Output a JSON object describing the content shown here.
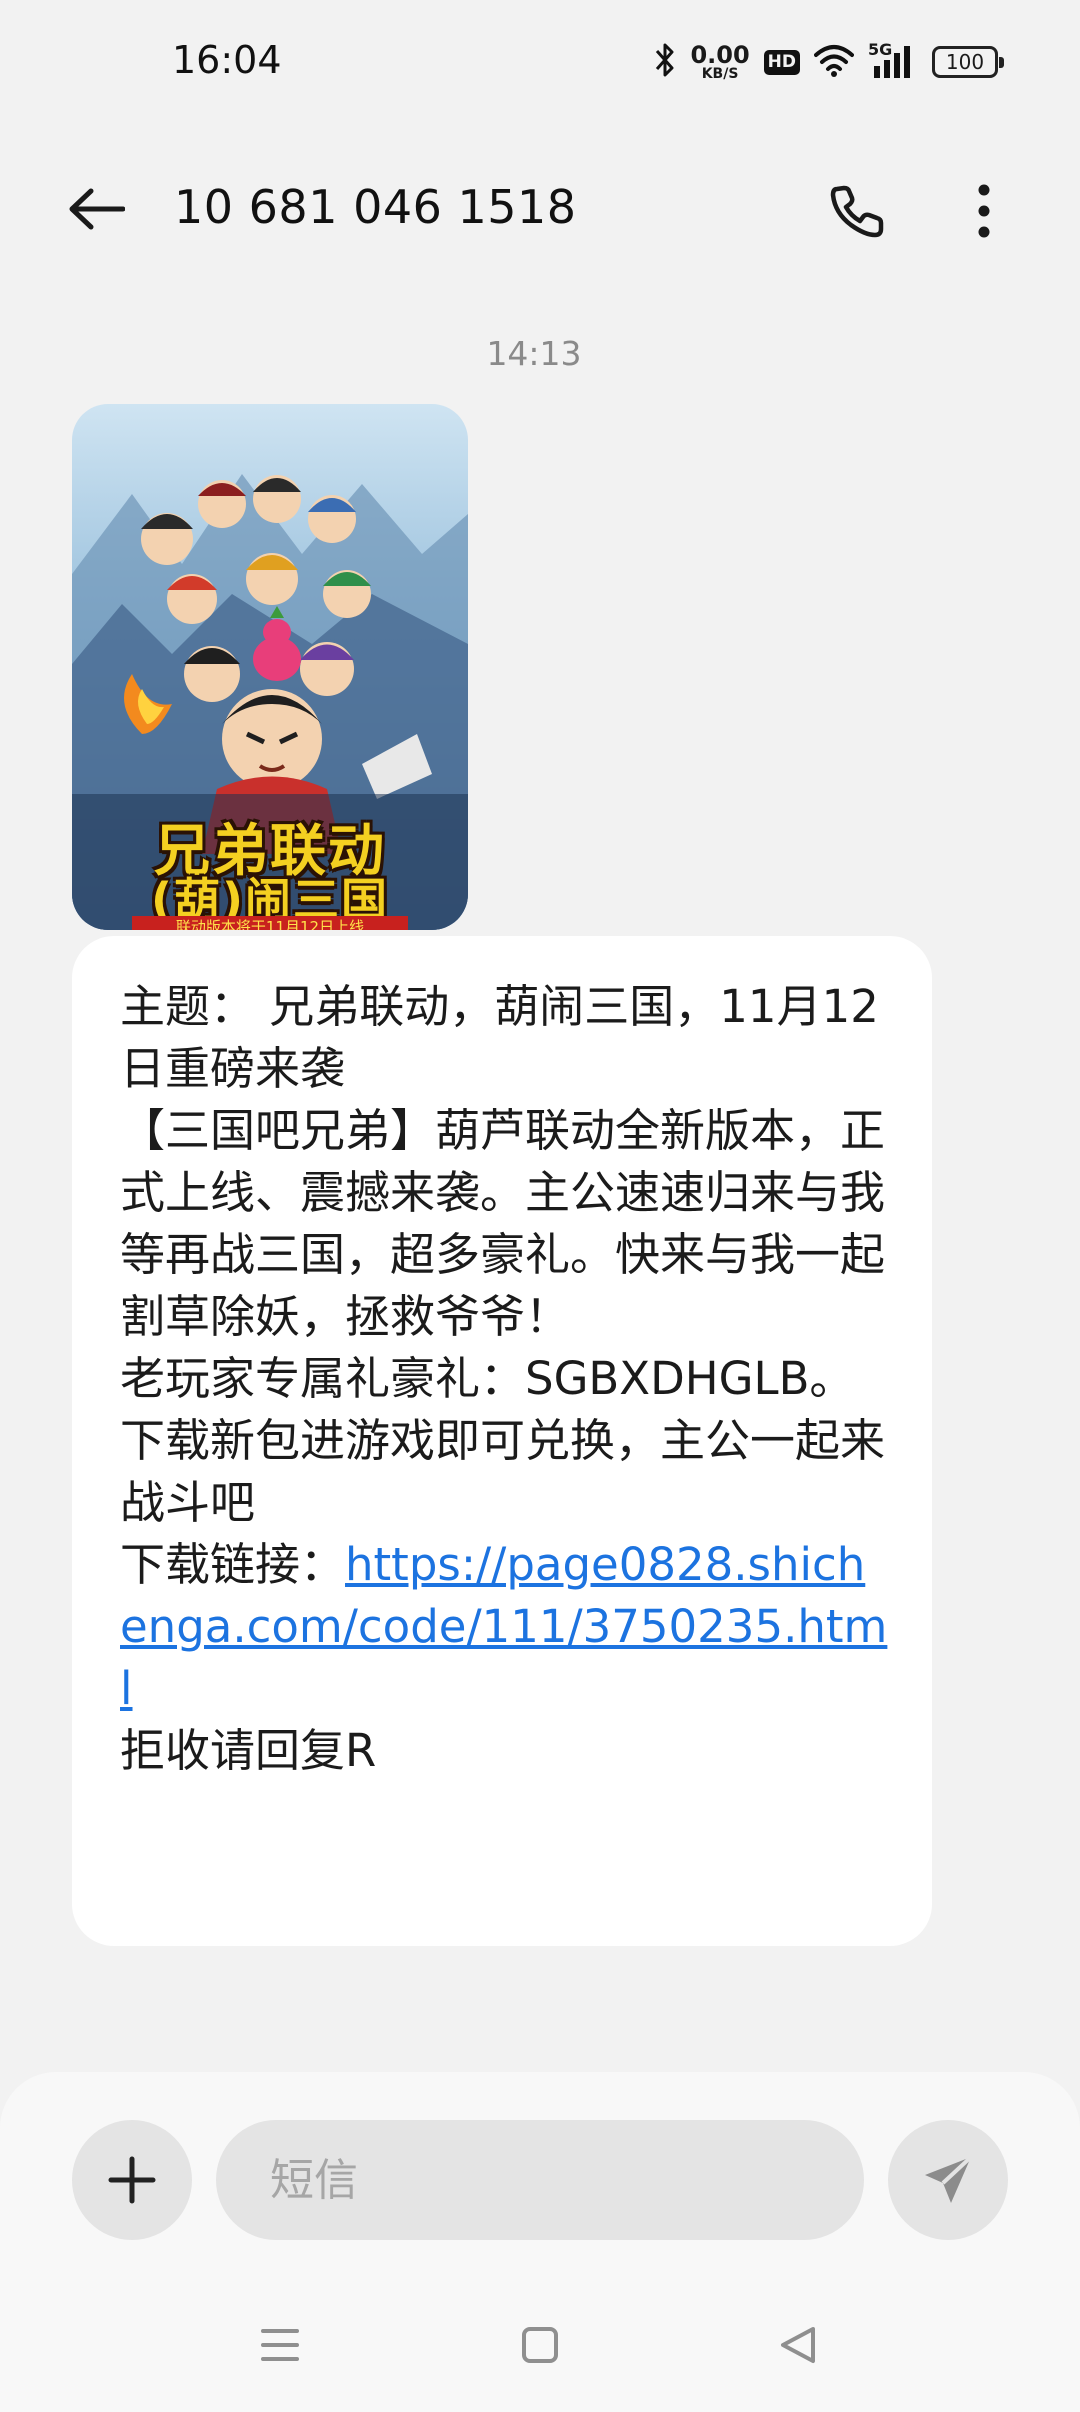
{
  "status_bar": {
    "time": "16:04",
    "net_speed_value": "0.00",
    "net_speed_unit": "KB/S",
    "hd_label": "HD",
    "network_label": "5G",
    "battery": "100"
  },
  "header": {
    "contact": "10 681 046 1518"
  },
  "conversation": {
    "timestamp": "14:13",
    "image": {
      "caption_line1": "兄弟联动",
      "caption_line2": "(葫)闹三国",
      "strip_text": "联动版本将于11月12日上线"
    },
    "message": {
      "subject": "主题： 兄弟联动，葫闹三国，11月12日重磅来袭",
      "body": "【三国吧兄弟】葫芦联动全新版本，正式上线、震撼来袭。主公速速归来与我等再战三国，超多豪礼。快来与我一起割草除妖，拯救爷爷！",
      "gift_code": "老玩家专属礼豪礼：SGBXDHGLB。",
      "instruction": "下载新包进游戏即可兑换，主公一起来战斗吧",
      "link_prefix": "下载链接：",
      "link": "https://page0828.shichenga.com/code/111/3750235.html",
      "optout": "拒收请回复R"
    }
  },
  "compose": {
    "placeholder": "短信"
  },
  "colors": {
    "background": "#f2f2f2",
    "bubble": "#ffffff",
    "link": "#1c73e0",
    "control": "#e4e4e4"
  },
  "icons": [
    "bluetooth-icon",
    "hd-icon",
    "wifi-icon",
    "signal-icon",
    "battery-icon",
    "back-arrow-icon",
    "phone-icon",
    "more-vertical-icon",
    "plus-icon",
    "send-icon",
    "menu-nav-icon",
    "home-nav-icon",
    "back-nav-icon"
  ]
}
